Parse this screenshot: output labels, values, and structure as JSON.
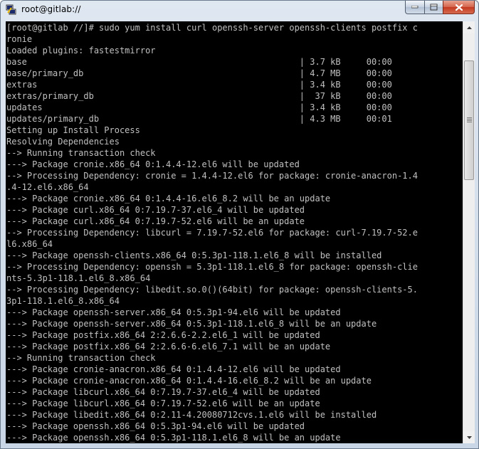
{
  "window": {
    "title": "root@gitlab://"
  },
  "terminal": {
    "lines": [
      "[root@gitlab //]# sudo yum install curl openssh-server openssh-clients postfix c",
      "ronie",
      "Loaded plugins: fastestmirror",
      "base                                                     | 3.7 kB     00:00",
      "base/primary_db                                          | 4.7 MB     00:00",
      "extras                                                   | 3.4 kB     00:00",
      "extras/primary_db                                        |  37 kB     00:00",
      "updates                                                  | 3.4 kB     00:00",
      "updates/primary_db                                       | 4.3 MB     00:01",
      "Setting up Install Process",
      "Resolving Dependencies",
      "--> Running transaction check",
      "---> Package cronie.x86_64 0:1.4.4-12.el6 will be updated",
      "--> Processing Dependency: cronie = 1.4.4-12.el6 for package: cronie-anacron-1.4",
      ".4-12.el6.x86_64",
      "---> Package cronie.x86_64 0:1.4.4-16.el6_8.2 will be an update",
      "---> Package curl.x86_64 0:7.19.7-37.el6_4 will be updated",
      "---> Package curl.x86_64 0:7.19.7-52.el6 will be an update",
      "--> Processing Dependency: libcurl = 7.19.7-52.el6 for package: curl-7.19.7-52.e",
      "l6.x86_64",
      "---> Package openssh-clients.x86_64 0:5.3p1-118.1.el6_8 will be installed",
      "--> Processing Dependency: openssh = 5.3p1-118.1.el6_8 for package: openssh-clie",
      "nts-5.3p1-118.1.el6_8.x86_64",
      "--> Processing Dependency: libedit.so.0()(64bit) for package: openssh-clients-5.",
      "3p1-118.1.el6_8.x86_64",
      "---> Package openssh-server.x86_64 0:5.3p1-94.el6 will be updated",
      "---> Package openssh-server.x86_64 0:5.3p1-118.1.el6_8 will be an update",
      "---> Package postfix.x86_64 2:2.6.6-2.2.el6_1 will be updated",
      "---> Package postfix.x86_64 2:2.6.6-6.el6_7.1 will be an update",
      "--> Running transaction check",
      "---> Package cronie-anacron.x86_64 0:1.4.4-12.el6 will be updated",
      "---> Package cronie-anacron.x86_64 0:1.4.4-16.el6_8.2 will be an update",
      "---> Package libcurl.x86_64 0:7.19.7-37.el6_4 will be updated",
      "---> Package libcurl.x86_64 0:7.19.7-52.el6 will be an update",
      "---> Package libedit.x86_64 0:2.11-4.20080712cvs.1.el6 will be installed",
      "---> Package openssh.x86_64 0:5.3p1-94.el6 will be updated",
      "---> Package openssh.x86_64 0:5.3p1-118.1.el6_8 will be an update"
    ]
  },
  "icons": {
    "app": "putty-icon",
    "minimize": "minimize-icon",
    "maximize": "maximize-icon",
    "close": "close-icon",
    "scroll_up": "scroll-up-arrow-icon",
    "scroll_down": "scroll-down-arrow-icon"
  },
  "colors": {
    "terminal_background": "#000000",
    "terminal_text": "#c0c0c0",
    "close_button": "#c2391f"
  }
}
